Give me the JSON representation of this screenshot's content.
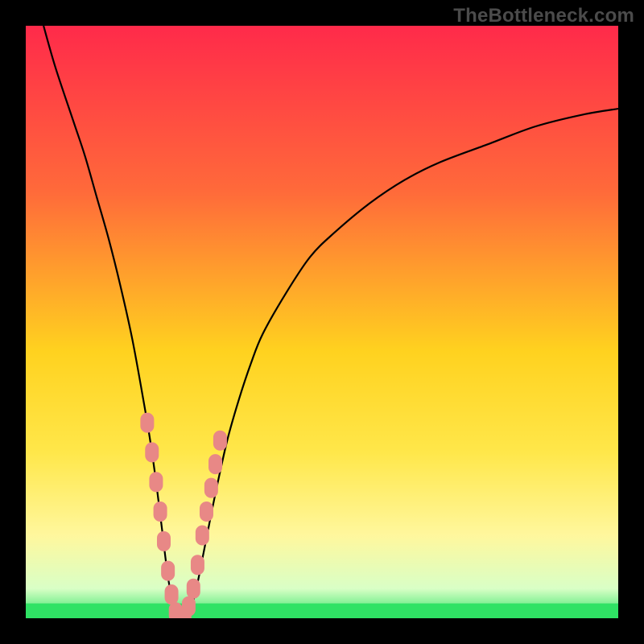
{
  "watermark": "TheBottleneck.com",
  "colors": {
    "bg_black": "#000000",
    "curve": "#000000",
    "marker_fill": "#e88886",
    "marker_stroke": "#e88886",
    "green_band": "#2fe264",
    "gradient_top": "#ff2a4a",
    "gradient_mid_upper": "#ff6a3a",
    "gradient_mid": "#ffd21f",
    "gradient_mid_lower": "#ffe74a",
    "gradient_pale": "#fff79d",
    "gradient_bottom_pale": "#d9ffc6"
  },
  "chart_data": {
    "type": "line",
    "title": "",
    "xlabel": "",
    "ylabel": "",
    "xlim": [
      0,
      100
    ],
    "ylim": [
      0,
      100
    ],
    "series": [
      {
        "name": "bottleneck-curve",
        "x": [
          3,
          5,
          8,
          10,
          12,
          14,
          16,
          18,
          20,
          21,
          22,
          23,
          24,
          25,
          26,
          27,
          28,
          29,
          30,
          32,
          34,
          36,
          38,
          40,
          44,
          48,
          52,
          58,
          64,
          70,
          78,
          86,
          94,
          100
        ],
        "y": [
          100,
          93,
          84,
          78,
          71,
          64,
          56,
          47,
          36,
          30,
          23,
          15,
          7,
          2,
          0,
          0,
          2,
          6,
          11,
          21,
          30,
          37,
          43,
          48,
          55,
          61,
          65,
          70,
          74,
          77,
          80,
          83,
          85,
          86
        ]
      }
    ],
    "markers": {
      "name": "highlight-points",
      "x": [
        20.5,
        21.3,
        22.0,
        22.7,
        23.3,
        24.0,
        24.6,
        25.3,
        26.0,
        26.8,
        27.5,
        28.3,
        29.0,
        29.8,
        30.5,
        31.3,
        32.0,
        32.8
      ],
      "y": [
        33,
        28,
        23,
        18,
        13,
        8,
        4,
        1,
        0,
        0,
        2,
        5,
        9,
        14,
        18,
        22,
        26,
        30
      ]
    },
    "background_bands": [
      {
        "name": "green-band",
        "y_from": 0,
        "y_to": 2.5
      }
    ]
  }
}
